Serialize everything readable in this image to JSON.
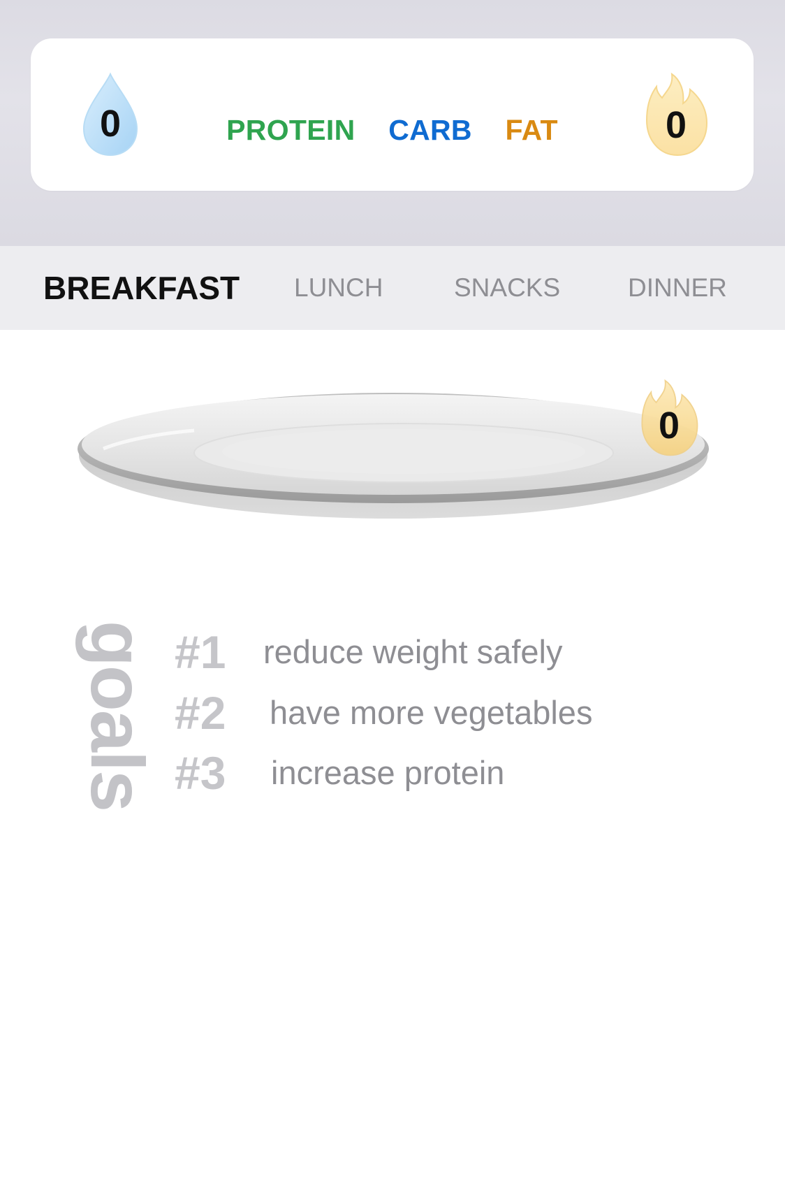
{
  "summary": {
    "water_count": "0",
    "calories_count": "0",
    "macros": {
      "protein": "PROTEIN",
      "carb": "CARB",
      "fat": "FAT"
    },
    "colors": {
      "protein": "#2fa44f",
      "carb": "#0f6bd1",
      "fat": "#d98a12"
    },
    "icons": {
      "water": "water-drop-icon",
      "calories": "flame-icon"
    }
  },
  "meal_tabs": {
    "items": [
      {
        "label": "BREAKFAST",
        "active": true
      },
      {
        "label": "LUNCH",
        "active": false
      },
      {
        "label": "SNACKS",
        "active": false
      },
      {
        "label": "DINNER",
        "active": false
      }
    ]
  },
  "plate": {
    "calories_count": "0",
    "icon": "flame-icon"
  },
  "goals": {
    "heading": "goals",
    "items": [
      {
        "number": "#1",
        "text": "reduce weight safely"
      },
      {
        "number": "#2",
        "text": "have more vegetables"
      },
      {
        "number": "#3",
        "text": "increase protein"
      }
    ]
  }
}
